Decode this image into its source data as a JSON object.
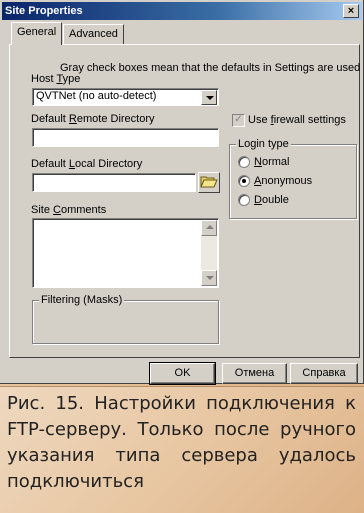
{
  "window": {
    "title": "Site Properties",
    "close_label": "×"
  },
  "tabs": [
    {
      "label": "General",
      "active": true
    },
    {
      "label": "Advanced",
      "active": false
    }
  ],
  "general": {
    "hint": "Gray check boxes mean that the defaults in Settings are used",
    "host_type": {
      "label_pre": "Host ",
      "label_u": "T",
      "label_post": "ype",
      "value": "QVTNet (no auto-detect)"
    },
    "remote_dir": {
      "label_pre": "Default ",
      "label_u": "R",
      "label_post": "emote Directory",
      "value": ""
    },
    "local_dir": {
      "label_pre": "Default ",
      "label_u": "L",
      "label_post": "ocal Directory",
      "value": ""
    },
    "site_comments": {
      "label_pre": "Site ",
      "label_u": "C",
      "label_post": "omments",
      "value": ""
    },
    "filtering": {
      "label": "Filtering (Masks)"
    },
    "firewall": {
      "label_pre": "Use ",
      "label_u": "f",
      "label_post": "irewall settings",
      "checked": true,
      "grayed": true
    },
    "login_type": {
      "label": "Login type",
      "options": [
        {
          "u": "N",
          "rest": "ormal",
          "selected": false
        },
        {
          "u": "A",
          "rest": "nonymous",
          "selected": true
        },
        {
          "u": "D",
          "rest": "ouble",
          "selected": false
        }
      ]
    }
  },
  "buttons": {
    "ok": "OK",
    "cancel": "Отмена",
    "help": "Справка"
  },
  "caption": "Рис. 15. Настройки подключения к FTP-серверу. Только после руч­ного указания типа сервера уда­лось подключиться",
  "colors": {
    "titlebar": "#0a246a",
    "dialog_bg": "#d4d0c8",
    "page_bg": "#e7c49d"
  },
  "icons": {
    "folder": "open-folder-icon",
    "dropdown": "chevron-down-icon",
    "checkmark": "check-icon"
  }
}
